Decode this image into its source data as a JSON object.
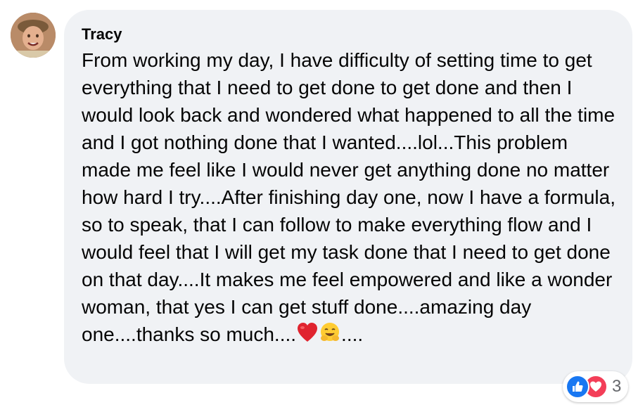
{
  "comment": {
    "author": "Tracy",
    "text": "From working my day, I have difficulty of setting time to get everything that I need to get done to get done and then I would look back and wondered what happened to all the time and I got nothing done that I wanted....lol...This problem made me feel like I would never get anything done no matter how hard I try....After finishing day one, now I have a formula, so to speak, that I can follow to make everything flow and I would feel that I will get my task done that I need to get done on that day....It makes me feel empowered and like a wonder woman, that yes I can get stuff done....amazing day one....thanks so much....",
    "text_tail": "....",
    "emojis": [
      "red-heart-icon",
      "hugging-face-icon"
    ]
  },
  "avatar": {
    "icon": "avatar"
  },
  "reactions": {
    "icons": [
      "like-icon",
      "love-icon"
    ],
    "count": "3",
    "colors": {
      "like": "#1877f2",
      "love": "#f33e58"
    }
  },
  "colors": {
    "bubble": "#f0f2f5",
    "text": "#050505",
    "secondary": "#65676b"
  }
}
